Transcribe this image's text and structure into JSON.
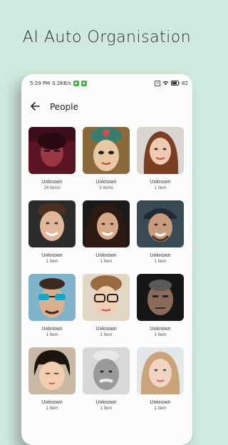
{
  "promo": {
    "title": "AI Auto Organisation"
  },
  "status": {
    "time": "5:29 PM",
    "speed": "0.2KB/s",
    "battery": "82"
  },
  "header": {
    "title": "People",
    "back_icon": "arrow-left-icon"
  },
  "people": [
    {
      "label": "Unknown",
      "count": "24 Items"
    },
    {
      "label": "Unknown",
      "count": "3 Items"
    },
    {
      "label": "Unknown",
      "count": "1 Item"
    },
    {
      "label": "Unknown",
      "count": "1 Item"
    },
    {
      "label": "Unknown",
      "count": "1 Item"
    },
    {
      "label": "Unknown",
      "count": "1 Item"
    },
    {
      "label": "Unknown",
      "count": "1 Item"
    },
    {
      "label": "Unknown",
      "count": "1 Item"
    },
    {
      "label": "Unknown",
      "count": "1 Item"
    },
    {
      "label": "Unknown",
      "count": "1 Item"
    },
    {
      "label": "Unknown",
      "count": "1 Item"
    },
    {
      "label": "Unknown",
      "count": "1 Item"
    }
  ],
  "colors": {
    "background": "#cfe9df",
    "status_badge": "#4caf50"
  }
}
